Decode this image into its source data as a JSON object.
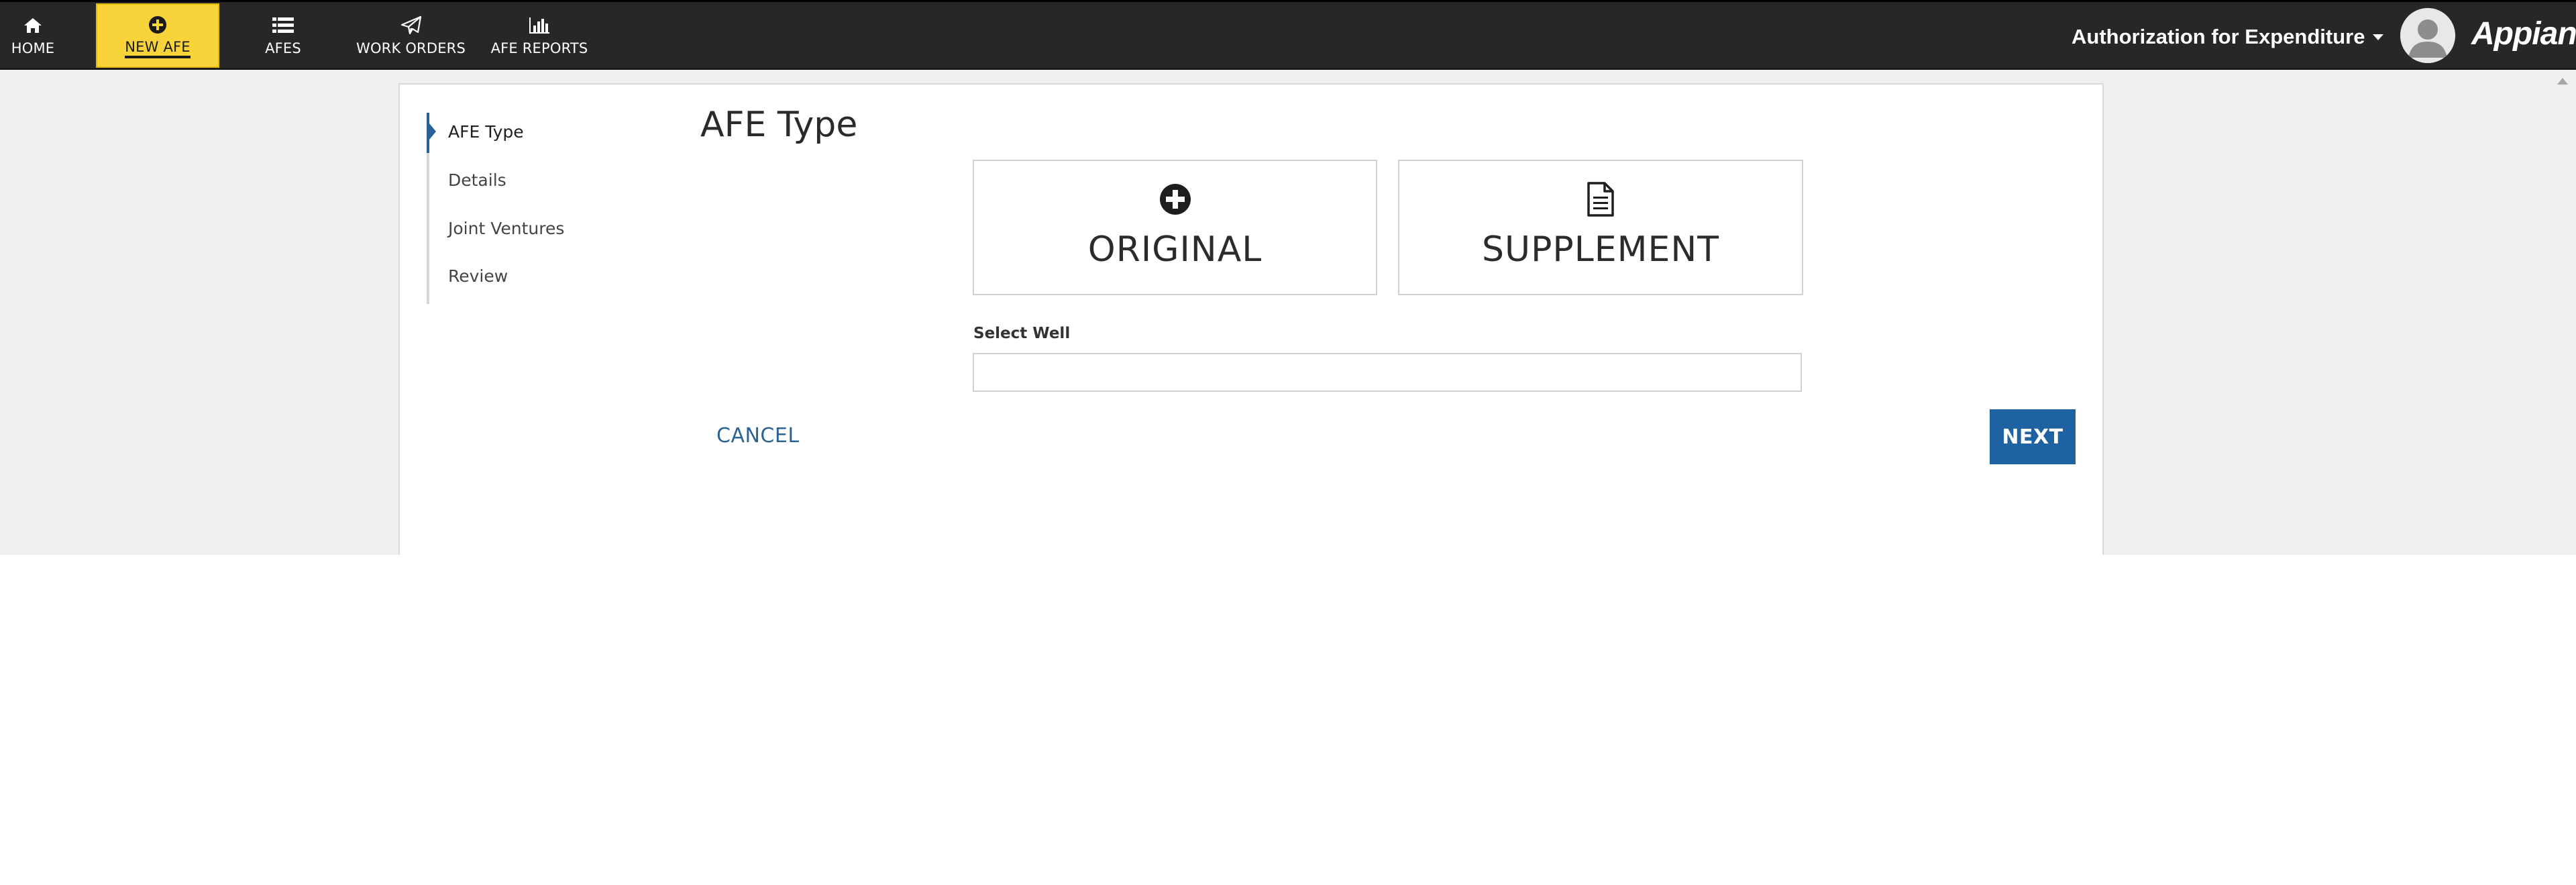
{
  "nav": {
    "items": [
      {
        "label": "HOME",
        "icon": "home-icon"
      },
      {
        "label": "NEW AFE",
        "icon": "plus-circle-icon",
        "active": true
      },
      {
        "label": "AFES",
        "icon": "list-icon"
      },
      {
        "label": "WORK ORDERS",
        "icon": "paper-plane-icon"
      },
      {
        "label": "AFE REPORTS",
        "icon": "bar-chart-icon"
      }
    ],
    "app_title": "Authorization for Expenditure",
    "brand": "Appian",
    "active_color": "#f8d43a",
    "bar_color": "#272727"
  },
  "steps": [
    {
      "label": "AFE Type",
      "current": true
    },
    {
      "label": "Details"
    },
    {
      "label": "Joint Ventures"
    },
    {
      "label": "Review"
    }
  ],
  "form": {
    "heading": "AFE Type",
    "types": [
      {
        "label": "ORIGINAL",
        "icon": "plus-circle-icon"
      },
      {
        "label": "SUPPLEMENT",
        "icon": "document-icon"
      }
    ],
    "select_well_label": "Select Well",
    "select_well_value": "",
    "cancel_label": "CANCEL",
    "next_label": "NEXT",
    "accent_color": "#1f62a1"
  }
}
